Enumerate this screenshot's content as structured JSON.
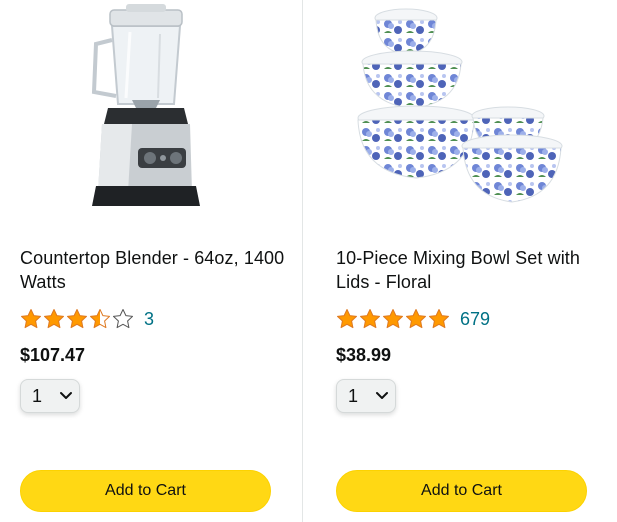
{
  "products": [
    {
      "title": "Countertop Blender - 64oz, 1400 Watts",
      "rating": 3.5,
      "rating_count": "3",
      "price": "$107.47",
      "quantity": "1",
      "add_to_cart_label": "Add to Cart"
    },
    {
      "title": "10-Piece Mixing Bowl Set with Lids - Floral",
      "rating": 5,
      "rating_count": "679",
      "price": "$38.99",
      "quantity": "1",
      "add_to_cart_label": "Add to Cart"
    }
  ],
  "colors": {
    "star": "#ff9900",
    "star_outline": "#de7921",
    "link": "#007185",
    "button": "#ffd814",
    "divider": "#e3e6e6"
  },
  "icons": {
    "star_full": "star-icon",
    "star_half": "star-half-icon",
    "star_empty": "star-empty-icon",
    "qty_chevron": "chevron-down-icon"
  }
}
